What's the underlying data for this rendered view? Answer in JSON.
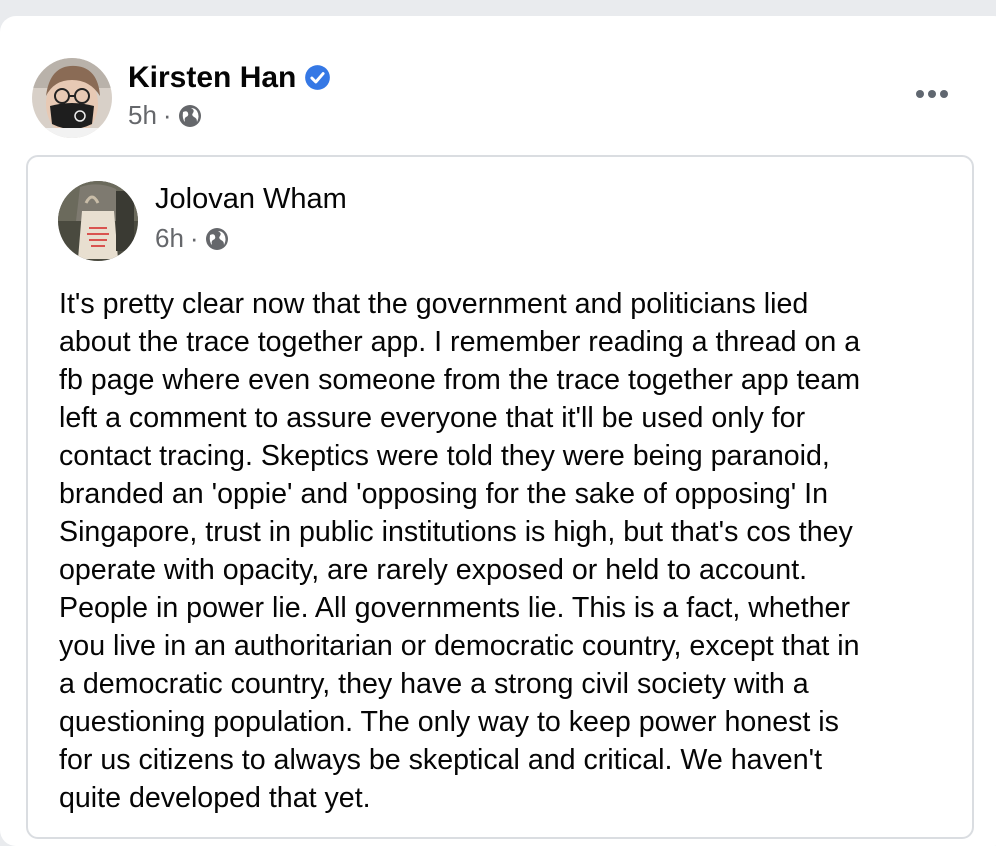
{
  "post": {
    "author_name": "Kirsten Han",
    "verified": true,
    "timestamp": "5h",
    "separator": "·",
    "audience_icon": "globe-icon",
    "more_icon": "more-options-icon"
  },
  "shared_post": {
    "author_name": "Jolovan Wham",
    "timestamp": "6h",
    "separator": "·",
    "audience_icon": "globe-icon",
    "text": "It's pretty clear now that the government and politicians lied\nabout the trace together app. I remember reading a thread on a\nfb page where even someone from the trace together app team\nleft a comment to assure everyone that it'll be used only for\ncontact tracing. Skeptics were told they were being paranoid,\nbranded an 'oppie' and 'opposing for the sake of opposing' In\nSingapore, trust in public institutions is high, but that's cos they\noperate with opacity, are rarely exposed or held to account.\nPeople in power lie. All governments lie. This is a fact, whether\nyou live in an authoritarian or democratic country, except that in\na democratic country, they have a strong civil society with a\nquestioning population. The only way to keep power honest is\nfor us citizens to always be skeptical and critical. We haven't\nquite developed that yet."
  },
  "colors": {
    "verified_badge": "#3578e5",
    "secondary_text": "#65676b",
    "border": "#dadde1"
  }
}
